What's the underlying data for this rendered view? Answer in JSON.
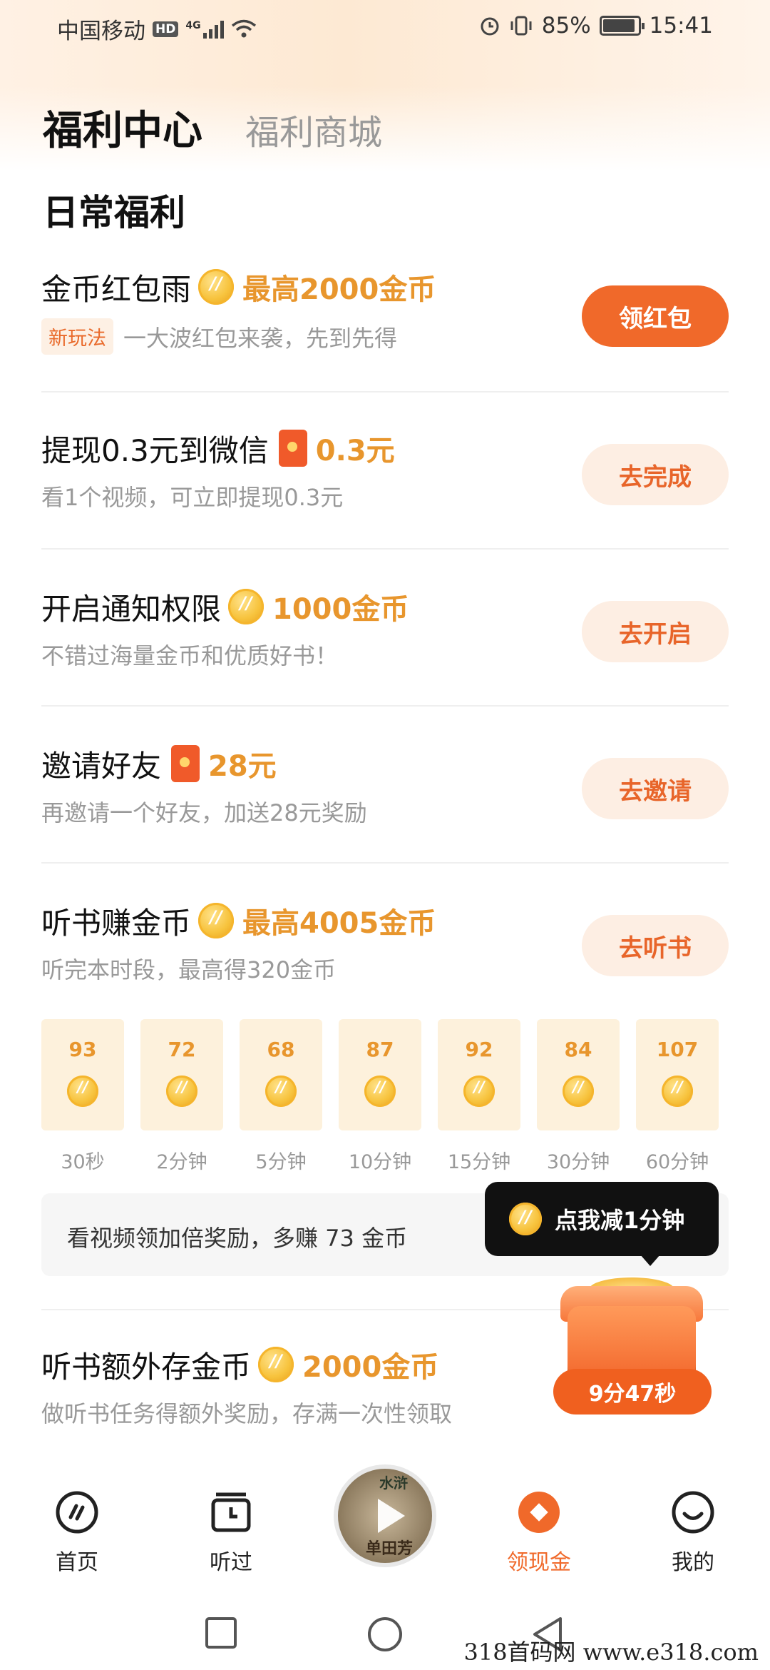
{
  "status_bar": {
    "carrier": "中国移动",
    "hd": "HD",
    "network": "4G",
    "battery": "85%",
    "time": "15:41"
  },
  "header": {
    "tab_active": "福利中心",
    "tab_other": "福利商城"
  },
  "section_title": "日常福利",
  "tasks": [
    {
      "title": "金币红包雨",
      "reward": "最高2000金币",
      "reward_icon": "coin-icon",
      "badge": "新玩法",
      "desc": "一大波红包来袭，先到先得",
      "button": "领红包"
    },
    {
      "title": "提现0.3元到微信",
      "reward": "0.3元",
      "reward_icon": "red-packet-icon",
      "desc": "看1个视频，可立即提现0.3元",
      "button": "去完成"
    },
    {
      "title": "开启通知权限",
      "reward": "1000金币",
      "reward_icon": "coin-icon",
      "desc": "不错过海量金币和优质好书！",
      "button": "去开启"
    },
    {
      "title": "邀请好友",
      "reward": "28元",
      "reward_icon": "red-packet-icon",
      "desc": "再邀请一个好友，加送28元奖励",
      "button": "去邀请"
    },
    {
      "title": "听书赚金币",
      "reward": "最高4005金币",
      "reward_icon": "coin-icon",
      "desc": "听完本时段，最高得320金币",
      "button": "去听书"
    }
  ],
  "listen_tiles": [
    {
      "value": "93",
      "label": "30秒"
    },
    {
      "value": "72",
      "label": "2分钟"
    },
    {
      "value": "68",
      "label": "5分钟"
    },
    {
      "value": "87",
      "label": "10分钟"
    },
    {
      "value": "92",
      "label": "15分钟"
    },
    {
      "value": "84",
      "label": "30分钟"
    },
    {
      "value": "107",
      "label": "60分钟"
    }
  ],
  "bonus_bar": {
    "text": "看视频领加倍奖励，多赚 73 金币"
  },
  "tooltip": {
    "text": "点我减1分钟"
  },
  "extra_task": {
    "title": "听书额外存金币",
    "reward": "2000金币",
    "desc": "做听书任务得额外奖励，存满一次性领取"
  },
  "chest": {
    "timer": "9分47秒"
  },
  "bottom_nav": {
    "items": [
      {
        "label": "首页",
        "icon": "home-icon"
      },
      {
        "label": "听过",
        "icon": "history-calendar-icon"
      },
      {
        "label": "领现金",
        "icon": "cash-icon",
        "active": true
      },
      {
        "label": "我的",
        "icon": "profile-smile-icon"
      }
    ],
    "player": {
      "cover_text_top": "水浒",
      "cover_text_bottom": "单田芳"
    }
  },
  "watermark": "318首码网 www.e318.com",
  "colors": {
    "accent": "#f0692a",
    "reward": "#e8962d",
    "soft_button": "#fdeee3",
    "tile_bg": "#fdf1dc"
  }
}
